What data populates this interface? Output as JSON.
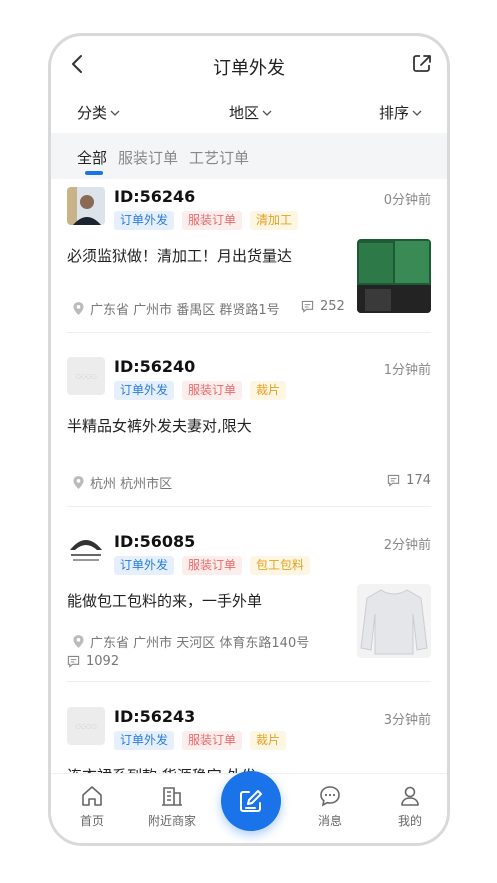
{
  "header": {
    "title": "订单外发",
    "back_icon": "chevron-left-icon",
    "share_icon": "share-icon"
  },
  "filters": [
    {
      "label": "分类"
    },
    {
      "label": "地区"
    },
    {
      "label": "排序"
    }
  ],
  "tabs": [
    {
      "label": "全部",
      "active": true
    },
    {
      "label": "服装订单",
      "active": false
    },
    {
      "label": "工艺订单",
      "active": false
    }
  ],
  "orders": [
    {
      "id": "ID:56246",
      "time": "0分钟前",
      "tags": [
        "订单外发",
        "服装订单",
        "清加工"
      ],
      "desc": "必须监狱做！清加工！月出货量达",
      "location": "广东省  广州市  番禺区  群贤路1号",
      "comments": "252"
    },
    {
      "id": "ID:56240",
      "time": "1分钟前",
      "tags": [
        "订单外发",
        "服装订单",
        "裁片"
      ],
      "desc": "半精品女裤外发夫妻对,限大",
      "location": "杭州  杭州市区",
      "comments": "174"
    },
    {
      "id": "ID:56085",
      "time": "2分钟前",
      "tags": [
        "订单外发",
        "服装订单",
        "包工包料"
      ],
      "desc": "能做包工包料的来，一手外单",
      "location": "广东省  广州市  天河区  体育东路140号",
      "comments": "1092"
    },
    {
      "id": "ID:56243",
      "time": "3分钟前",
      "tags": [
        "订单外发",
        "服装订单",
        "裁片"
      ],
      "desc": "连衣裙系列款,货源稳定 外发"
    }
  ],
  "tabbar": [
    {
      "label": "首页",
      "icon": "home-icon"
    },
    {
      "label": "附近商家",
      "icon": "building-icon"
    },
    {
      "label": "消息",
      "icon": "message-icon"
    },
    {
      "label": "我的",
      "icon": "user-icon"
    }
  ],
  "colors": {
    "accent": "#1a73e8",
    "tag_blue": "#2a7ae2",
    "tag_pink": "#e86a6a",
    "tag_yellow": "#e6a020"
  }
}
